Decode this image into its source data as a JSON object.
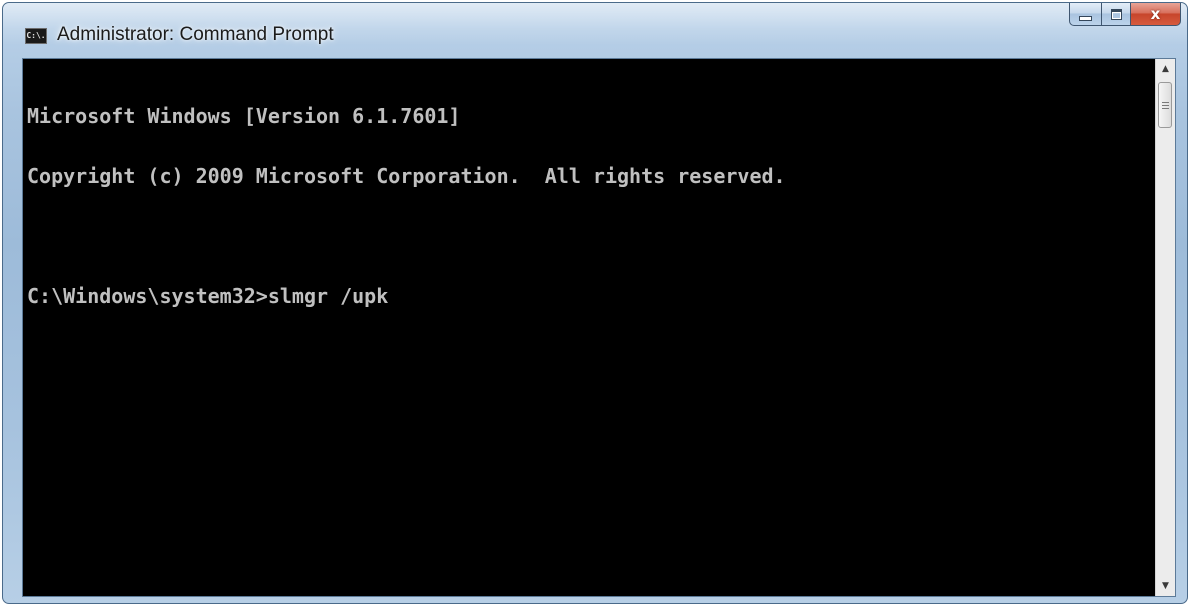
{
  "window": {
    "title": "Administrator: Command Prompt",
    "icon": "cmd-icon",
    "icon_text": "C:\\."
  },
  "caption_buttons": {
    "minimize_icon": "minimize-icon",
    "maximize_icon": "maximize-icon",
    "close_icon": "close-icon",
    "close_glyph": "x"
  },
  "console": {
    "lines": [
      "Microsoft Windows [Version 6.1.7601]",
      "Copyright (c) 2009 Microsoft Corporation.  All rights reserved.",
      "",
      "C:\\Windows\\system32>slmgr /upk"
    ],
    "text_color": "#c0c0c0",
    "background_color": "#000000"
  },
  "scrollbar": {
    "up_icon": "scroll-up-arrow-icon",
    "down_icon": "scroll-down-arrow-icon",
    "up_glyph": "▲",
    "down_glyph": "▼"
  }
}
